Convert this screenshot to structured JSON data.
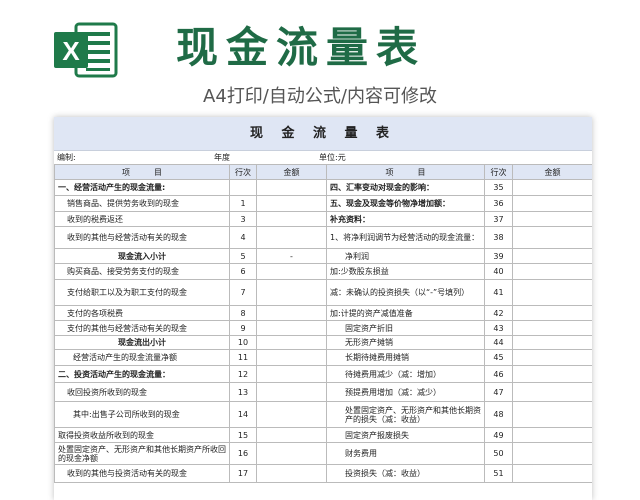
{
  "header": {
    "logo_letter": "X",
    "title": "现金流量表",
    "subtitle": "A4打印/自动公式/内容可修改"
  },
  "sheet": {
    "title": "现 金 流 量 表",
    "meta": {
      "compiler": "编制:",
      "year": "年度",
      "unit": "单位:元"
    },
    "columns": [
      "项　　　目",
      "行次",
      "金额",
      "项　　　目",
      "行次",
      "金额"
    ],
    "rows": [
      {
        "l": "一、经营活动产生的现金流量:",
        "ln": "",
        "la": "",
        "lstyle": "b",
        "r": "四、汇率变动对现金的影响：",
        "rn": "35",
        "ra": "",
        "rstyle": "b",
        "h": 16
      },
      {
        "l": "销售商品、提供劳务收到的现金",
        "ln": "1",
        "la": "",
        "lstyle": "ind1",
        "r": "五、现金及现金等价物净增加额：",
        "rn": "36",
        "ra": "",
        "rstyle": "b",
        "h": 16
      },
      {
        "l": "收到的税费返还",
        "ln": "3",
        "la": "",
        "lstyle": "ind1",
        "r": "补充资料：",
        "rn": "37",
        "ra": "",
        "rstyle": "b",
        "h": 15
      },
      {
        "l": "收到的其他与经营活动有关的现金",
        "ln": "4",
        "la": "",
        "lstyle": "ind1",
        "r": "1、将净利润调节为经营活动的现金流量：",
        "rn": "38",
        "ra": "",
        "rstyle": "",
        "h": 22
      },
      {
        "l": "现金流入小计",
        "ln": "5",
        "la": "-",
        "lstyle": "b ctr",
        "r": "净利润",
        "rn": "39",
        "ra": "",
        "rstyle": "ind2",
        "h": 15
      },
      {
        "l": "购买商品、接受劳务支付的现金",
        "ln": "6",
        "la": "",
        "lstyle": "ind1",
        "r": "加:少数股东损益",
        "rn": "40",
        "ra": "",
        "rstyle": "",
        "h": 16
      },
      {
        "l": "支付给职工以及为职工支付的现金",
        "ln": "7",
        "la": "",
        "lstyle": "ind1",
        "r": "减：未确认的投资损失（以“-”号填列）",
        "rn": "41",
        "ra": "",
        "rstyle": "",
        "h": 26
      },
      {
        "l": "支付的各项税费",
        "ln": "8",
        "la": "",
        "lstyle": "ind1",
        "r": "加:计提的资产减值准备",
        "rn": "42",
        "ra": "",
        "rstyle": "",
        "h": 15
      },
      {
        "l": "支付的其他与经营活动有关的现金",
        "ln": "9",
        "la": "",
        "lstyle": "ind1",
        "r": "固定资产折旧",
        "rn": "43",
        "ra": "",
        "rstyle": "ind2",
        "h": 15
      },
      {
        "l": "现金流出小计",
        "ln": "10",
        "la": "",
        "lstyle": "b ctr",
        "r": "无形资产摊销",
        "rn": "44",
        "ra": "",
        "rstyle": "ind2",
        "h": 14
      },
      {
        "l": "经营活动产生的现金流量净额",
        "ln": "11",
        "la": "",
        "lstyle": "ind2",
        "r": "长期待摊费用摊销",
        "rn": "45",
        "ra": "",
        "rstyle": "ind2",
        "h": 16
      },
      {
        "l": "二、投资活动产生的现金流量：",
        "ln": "12",
        "la": "",
        "lstyle": "b",
        "r": "待摊费用减少（减：增加）",
        "rn": "46",
        "ra": "",
        "rstyle": "ind2",
        "h": 17
      },
      {
        "l": "收回投资所收到的现金",
        "ln": "13",
        "la": "",
        "lstyle": "ind1",
        "r": "预提费用增加（减：减少）",
        "rn": "47",
        "ra": "",
        "rstyle": "ind2",
        "h": 19
      },
      {
        "l": "其中:出售子公司所收到的现金",
        "ln": "14",
        "la": "",
        "lstyle": "ind2",
        "r": "处置固定资产、无形资产和其他长期资产的损失（减：收益）",
        "rn": "48",
        "ra": "",
        "rstyle": "ind2",
        "h": 26
      },
      {
        "l": "取得投资收益所收到的现金",
        "ln": "15",
        "la": "",
        "lstyle": "",
        "r": "固定资产报废损失",
        "rn": "49",
        "ra": "",
        "rstyle": "ind2",
        "h": 15
      },
      {
        "l": "处置固定资产、无形资产和其他长期资产所收回的现金净额",
        "ln": "16",
        "la": "",
        "lstyle": "",
        "r": "财务费用",
        "rn": "50",
        "ra": "",
        "rstyle": "ind2",
        "h": 22
      },
      {
        "l": "收到的其他与投资活动有关的现金",
        "ln": "17",
        "la": "",
        "lstyle": "ind1",
        "r": "投资损失（减：收益）",
        "rn": "51",
        "ra": "",
        "rstyle": "ind2",
        "h": 18
      }
    ]
  },
  "colors": {
    "brand_green": "#1f6b46",
    "header_fill": "#dfe6f4"
  }
}
